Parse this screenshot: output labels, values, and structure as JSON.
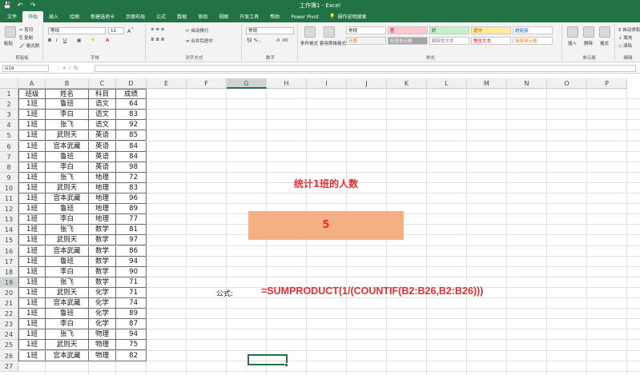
{
  "title_bar": {
    "title": "工作簿1 - Excel",
    "quick_access": [
      "💾",
      "↶",
      "↷"
    ]
  },
  "tabs": [
    {
      "label": "文件",
      "active": false
    },
    {
      "label": "开始",
      "active": true
    },
    {
      "label": "插入",
      "active": false
    },
    {
      "label": "绘图",
      "active": false
    },
    {
      "label": "新建选项卡",
      "active": false
    },
    {
      "label": "页面布局",
      "active": false
    },
    {
      "label": "公式",
      "active": false
    },
    {
      "label": "数据",
      "active": false
    },
    {
      "label": "审阅",
      "active": false
    },
    {
      "label": "视图",
      "active": false
    },
    {
      "label": "开发工具",
      "active": false
    },
    {
      "label": "帮助",
      "active": false
    },
    {
      "label": "Power Pivot",
      "active": false
    }
  ],
  "tell_me": "操作说明搜索",
  "ribbon": {
    "clipboard": {
      "label": "剪贴板",
      "paste": "粘贴",
      "cut": "剪切",
      "copy": "复制",
      "format_painter": "格式刷"
    },
    "font": {
      "label": "字体",
      "font_name": "等线",
      "font_size": "11"
    },
    "alignment": {
      "label": "对齐方式",
      "wrap": "自动换行",
      "merge": "合并后居中"
    },
    "number": {
      "label": "数字",
      "format": "常规"
    },
    "styles": {
      "label": "样式",
      "conditional": "条件格式",
      "table": "套用表格格式",
      "cells": [
        {
          "text": "常规",
          "color": "#ffffff",
          "fg": "#222222"
        },
        {
          "text": "差",
          "color": "#ffc7ce",
          "fg": "#9c0006"
        },
        {
          "text": "好",
          "color": "#c6efce",
          "fg": "#006100"
        },
        {
          "text": "适中",
          "color": "#ffeb9c",
          "fg": "#9c5700"
        },
        {
          "text": "超链接",
          "color": "#ffffff",
          "fg": "#0563c1"
        },
        {
          "text": "计算",
          "color": "#f2f2f2",
          "fg": "#fa7d00"
        },
        {
          "text": "检查单元格",
          "color": "#a5a5a5",
          "fg": "#ffffff"
        },
        {
          "text": "解释性文本",
          "color": "#ffffff",
          "fg": "#7f7f7f"
        },
        {
          "text": "警告文本",
          "color": "#ffffff",
          "fg": "#ff0000"
        },
        {
          "text": "链接单元格",
          "color": "#ffffff",
          "fg": "#fa7d00"
        }
      ]
    },
    "cells_group": {
      "label": "单元格",
      "insert": "插入",
      "delete": "删除",
      "format": "格式"
    },
    "editing": {
      "label": "编辑",
      "sum": "Σ 自动求和",
      "fill": "↓ 填充",
      "clear": "◇ 清除"
    }
  },
  "formula_bar": {
    "name_box": "G19",
    "fx": "fx",
    "content": ""
  },
  "columns": [
    "A",
    "B",
    "C",
    "D",
    "E",
    "F",
    "G",
    "H",
    "I",
    "J",
    "K",
    "L",
    "M",
    "N",
    "O",
    "P"
  ],
  "selected_column": "G",
  "selected_row": 19,
  "rows": [
    [
      "班级",
      "姓名",
      "科目",
      "成绩"
    ],
    [
      "1班",
      "鲁班",
      "语文",
      "64"
    ],
    [
      "1班",
      "李白",
      "语文",
      "83"
    ],
    [
      "1班",
      "张飞",
      "语文",
      "92"
    ],
    [
      "1班",
      "武则天",
      "英语",
      "85"
    ],
    [
      "1班",
      "宫本武藏",
      "英语",
      "84"
    ],
    [
      "1班",
      "鲁班",
      "英语",
      "84"
    ],
    [
      "1班",
      "李白",
      "英语",
      "98"
    ],
    [
      "1班",
      "张飞",
      "地理",
      "72"
    ],
    [
      "1班",
      "武则天",
      "地理",
      "83"
    ],
    [
      "1班",
      "宫本武藏",
      "地理",
      "96"
    ],
    [
      "1班",
      "鲁班",
      "地理",
      "89"
    ],
    [
      "1班",
      "李白",
      "地理",
      "77"
    ],
    [
      "1班",
      "张飞",
      "数学",
      "81"
    ],
    [
      "1班",
      "武则天",
      "数学",
      "97"
    ],
    [
      "1班",
      "宫本武藏",
      "数学",
      "86"
    ],
    [
      "1班",
      "鲁班",
      "数学",
      "94"
    ],
    [
      "1班",
      "李白",
      "数学",
      "90"
    ],
    [
      "1班",
      "张飞",
      "数学",
      "71"
    ],
    [
      "1班",
      "武则天",
      "化学",
      "71"
    ],
    [
      "1班",
      "宫本武藏",
      "化学",
      "74"
    ],
    [
      "1班",
      "鲁班",
      "化学",
      "89"
    ],
    [
      "1班",
      "李白",
      "化学",
      "87"
    ],
    [
      "1班",
      "张飞",
      "物理",
      "94"
    ],
    [
      "1班",
      "武则天",
      "物理",
      "75"
    ],
    [
      "1班",
      "宫本武藏",
      "物理",
      "82"
    ]
  ],
  "extra_row_number": "27",
  "annotations": {
    "title": "统计1班的人数",
    "result": "5",
    "formula_label": "公式:",
    "formula": "=SUMPRODUCT(1/(COUNTIF(B2:B26,B2:B26)))"
  },
  "colors": {
    "brand": "#217346",
    "accent_red": "#e03030",
    "result_fill": "#f4b083"
  }
}
